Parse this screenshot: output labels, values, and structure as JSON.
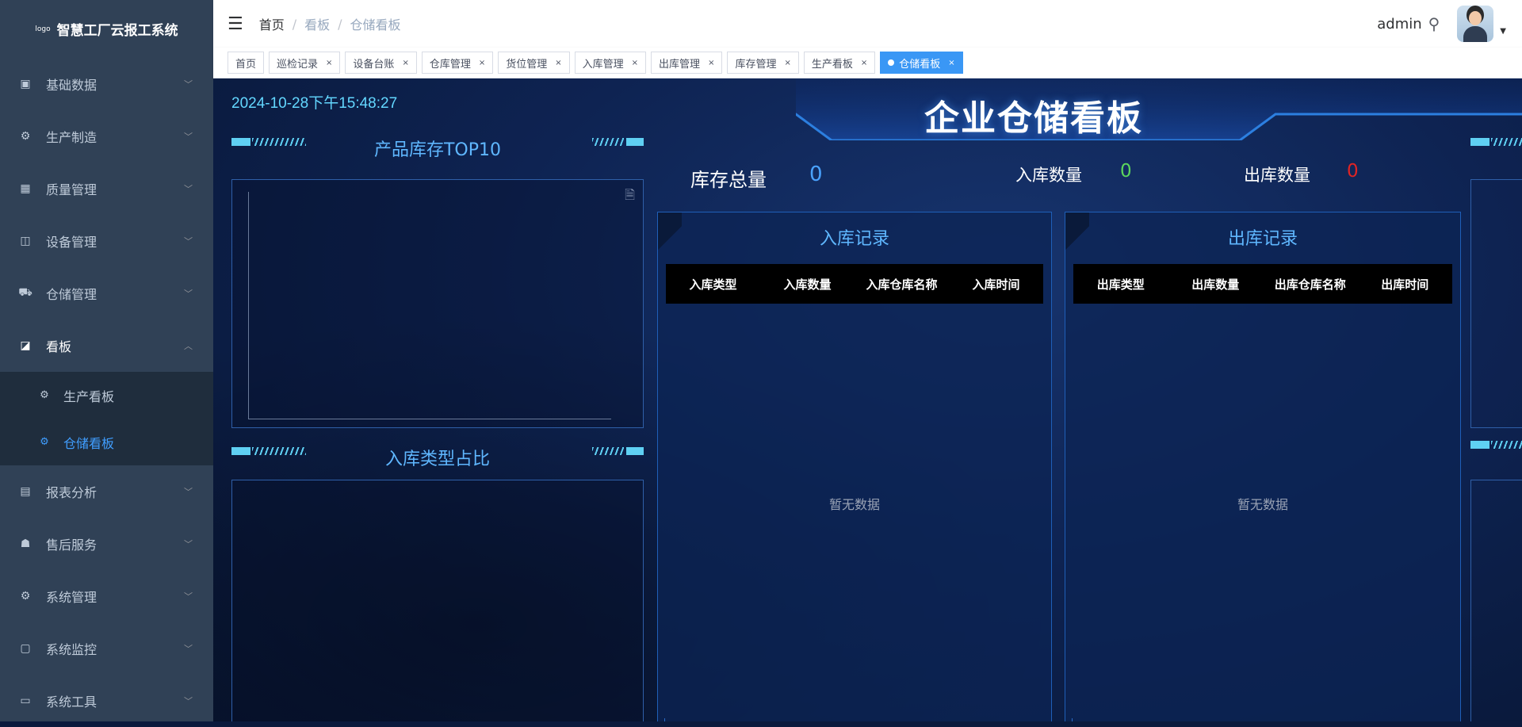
{
  "brand": {
    "logo": "logo",
    "name": "智慧工厂云报工系统"
  },
  "sidebar": {
    "items": [
      {
        "label": "基础数据",
        "icon": "▣"
      },
      {
        "label": "生产制造",
        "icon": "⚙"
      },
      {
        "label": "质量管理",
        "icon": "▦"
      },
      {
        "label": "设备管理",
        "icon": "◫"
      },
      {
        "label": "仓储管理",
        "icon": "⛟"
      },
      {
        "label": "看板",
        "icon": "◪"
      },
      {
        "label": "报表分析",
        "icon": "▤"
      },
      {
        "label": "售后服务",
        "icon": "☗"
      },
      {
        "label": "系统管理",
        "icon": "⚙"
      },
      {
        "label": "系统监控",
        "icon": "▢"
      },
      {
        "label": "系统工具",
        "icon": "▭"
      }
    ],
    "sub_items": [
      {
        "label": "生产看板",
        "icon": "⚙"
      },
      {
        "label": "仓储看板",
        "icon": "⚙"
      }
    ]
  },
  "navbar": {
    "breadcrumb": [
      "首页",
      "看板",
      "仓储看板"
    ],
    "username": "admin"
  },
  "tags": [
    {
      "label": "首页"
    },
    {
      "label": "巡检记录"
    },
    {
      "label": "设备台账"
    },
    {
      "label": "仓库管理"
    },
    {
      "label": "货位管理"
    },
    {
      "label": "入库管理"
    },
    {
      "label": "出库管理"
    },
    {
      "label": "库存管理"
    },
    {
      "label": "生产看板"
    },
    {
      "label": "仓储看板"
    }
  ],
  "dashboard": {
    "datetime": "2024-10-28下午15:48:27",
    "title": "企业仓储看板",
    "panel_top10": "产品库存TOP10",
    "panel_type_ratio": "入库类型占比",
    "stats": {
      "total_label": "库存总量",
      "total_value": "0",
      "in_label": "入库数量",
      "in_value": "0",
      "out_label": "出库数量",
      "out_value": "0"
    },
    "in_records": {
      "title": "入库记录",
      "columns": [
        "入库类型",
        "入库数量",
        "入库仓库名称",
        "入库时间"
      ],
      "empty": "暂无数据"
    },
    "out_records": {
      "title": "出库记录",
      "columns": [
        "出库类型",
        "出库数量",
        "出库仓库名称",
        "出库时间"
      ],
      "empty": "暂无数据"
    }
  },
  "colors": {
    "sidebar_bg": "#304156",
    "active": "#409eff",
    "in_value": "#5cd65c",
    "out_value": "#e02424",
    "total_value": "#4aa3ff"
  }
}
